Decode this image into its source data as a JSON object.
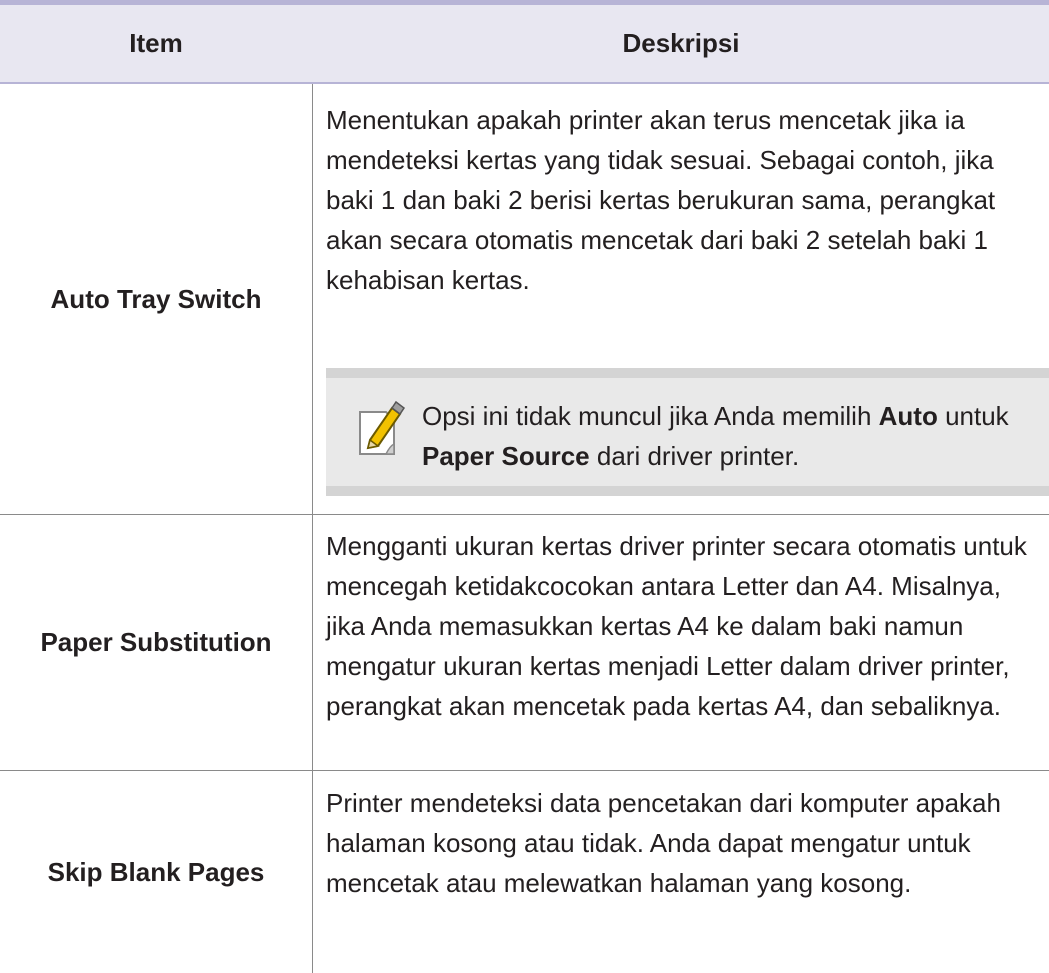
{
  "table": {
    "headers": {
      "item": "Item",
      "description": "Deskripsi"
    },
    "rows": [
      {
        "item": "Auto Tray Switch",
        "description": "Menentukan apakah printer akan terus mencetak jika ia mendeteksi kertas yang tidak sesuai. Sebagai contoh, jika baki 1 dan baki 2 berisi kertas berukuran sama, perangkat akan secara otomatis mencetak dari baki 2 setelah baki 1 kehabisan kertas.",
        "note": {
          "icon": "note-pencil-icon",
          "part1": "Opsi ini tidak muncul jika Anda memilih ",
          "bold1": "Auto",
          "part2": " untuk ",
          "bold2": "Paper Source",
          "part3": " dari driver printer."
        }
      },
      {
        "item": "Paper Substitution",
        "description": "Mengganti ukuran kertas driver printer secara otomatis untuk mencegah ketidakcocokan antara Letter dan A4. Misalnya, jika Anda memasukkan kertas A4 ke dalam baki namun mengatur ukuran kertas menjadi Letter dalam driver printer, perangkat akan mencetak pada kertas A4, dan sebaliknya."
      },
      {
        "item": "Skip Blank Pages",
        "description": "Printer mendeteksi data pencetakan dari komputer apakah halaman kosong atau tidak. Anda dapat mengatur untuk mencetak atau melewatkan halaman yang kosong."
      }
    ]
  },
  "colors": {
    "header_bg": "#e8e7f1",
    "header_rule": "#b7b4d6",
    "note_bg": "#e9e9e9",
    "text": "#231f20"
  }
}
